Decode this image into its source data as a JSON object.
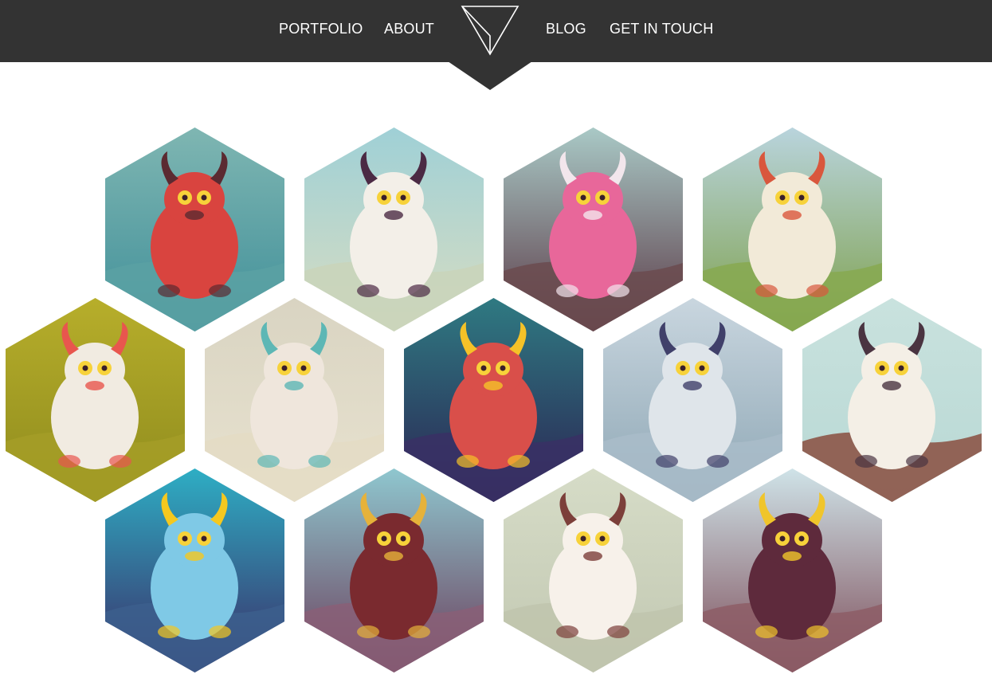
{
  "nav": {
    "items": [
      {
        "label": "PORTFOLIO"
      },
      {
        "label": "ABOUT"
      },
      {
        "label": "BLOG"
      },
      {
        "label": "GET IN TOUCH"
      }
    ],
    "logo_icon": "triangle-logo-icon"
  },
  "colors": {
    "header_bg": "#333333",
    "header_text": "#ffffff",
    "page_bg": "#ffffff"
  },
  "gallery": {
    "items": [
      {
        "subject": "red-horned-monster",
        "top": "#7fb6b2",
        "bottom": "#3f8f99",
        "ground": "#5aa1a3",
        "fig": "#d9443f",
        "accent": "#5b2a31"
      },
      {
        "subject": "flying-sheep-monster",
        "top": "#9fd0d6",
        "bottom": "#d8ddc2",
        "ground": "#c9d3ba",
        "fig": "#f3efe8",
        "accent": "#4b2a44"
      },
      {
        "subject": "pink-cow-monster",
        "top": "#a9c9c6",
        "bottom": "#5a3845",
        "ground": "#6b4b4f",
        "fig": "#e8679a",
        "accent": "#f2e6ec"
      },
      {
        "subject": "swinging-yeti-monster",
        "top": "#b9d4dd",
        "bottom": "#7ea04b",
        "ground": "#87a950",
        "fig": "#f2ead8",
        "accent": "#d9573d"
      },
      {
        "subject": "unicorn-pig-monster",
        "top": "#b7ae2b",
        "bottom": "#8e8b1d",
        "ground": "#a49e27",
        "fig": "#f1ebe1",
        "accent": "#e8564e"
      },
      {
        "subject": "deer-pyramid-creatures",
        "top": "#d9d4c2",
        "bottom": "#e8e2cf",
        "ground": "#e4dcc4",
        "fig": "#efe6dc",
        "accent": "#5db7b5"
      },
      {
        "subject": "octopus-worm-monster",
        "top": "#2f7a82",
        "bottom": "#2a2352",
        "ground": "#3a3065",
        "fig": "#d94f4a",
        "accent": "#f5c228"
      },
      {
        "subject": "two-horned-yetis",
        "top": "#c9d6df",
        "bottom": "#8da6b4",
        "ground": "#a9bcc9",
        "fig": "#dfe5ea",
        "accent": "#40406a"
      },
      {
        "subject": "white-yeti-pyramid-face",
        "top": "#c9e2de",
        "bottom": "#b8d8d4",
        "ground": "#8a4e3f",
        "fig": "#f4efe6",
        "accent": "#4a3441"
      },
      {
        "subject": "jellyfish-monster",
        "top": "#2eaec4",
        "bottom": "#3b2b66",
        "ground": "#3c5f8d",
        "fig": "#7fc9e6",
        "accent": "#f5c81f"
      },
      {
        "subject": "tribal-mask-monster",
        "top": "#8fc7cf",
        "bottom": "#6b3d5a",
        "ground": "#8a5f77",
        "fig": "#7a2a2f",
        "accent": "#e6b23a"
      },
      {
        "subject": "bird-and-bear-monsters",
        "top": "#d6dcc7",
        "bottom": "#c2c8b2",
        "ground": "#bfc4ad",
        "fig": "#f7f1ea",
        "accent": "#7c3f3a"
      },
      {
        "subject": "horned-scaly-monster",
        "top": "#cfe3e8",
        "bottom": "#7d4c58",
        "ground": "#8d5d66",
        "fig": "#5e2a3c",
        "accent": "#f0c52b"
      }
    ]
  }
}
